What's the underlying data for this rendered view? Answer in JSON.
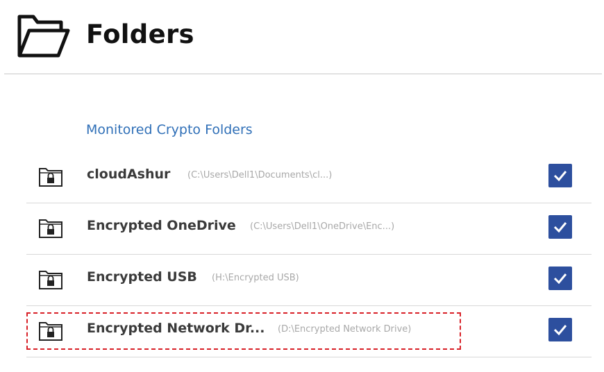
{
  "header": {
    "title": "Folders",
    "icon": "folder-outline-icon"
  },
  "section": {
    "heading": "Monitored Crypto Folders",
    "heading_color": "#2f6fb7"
  },
  "folders": [
    {
      "name": "cloudAshur",
      "path": "(C:\\Users\\Dell1\\Documents\\cl...)",
      "checked": true,
      "icon": "lock-folder-icon"
    },
    {
      "name": "Encrypted OneDrive",
      "path": "(C:\\Users\\Dell1\\OneDrive\\Enc...)",
      "checked": true,
      "icon": "lock-folder-icon"
    },
    {
      "name": "Encrypted USB",
      "path": "(H:\\Encrypted USB)",
      "checked": true,
      "icon": "lock-folder-icon"
    },
    {
      "name": "Encrypted Network Dr...",
      "path": "(D:\\Encrypted Network Drive)",
      "checked": true,
      "icon": "lock-folder-icon",
      "highlighted": true
    }
  ],
  "colors": {
    "checkbox": "#2d4f9e",
    "highlight_border": "#d81f26"
  }
}
